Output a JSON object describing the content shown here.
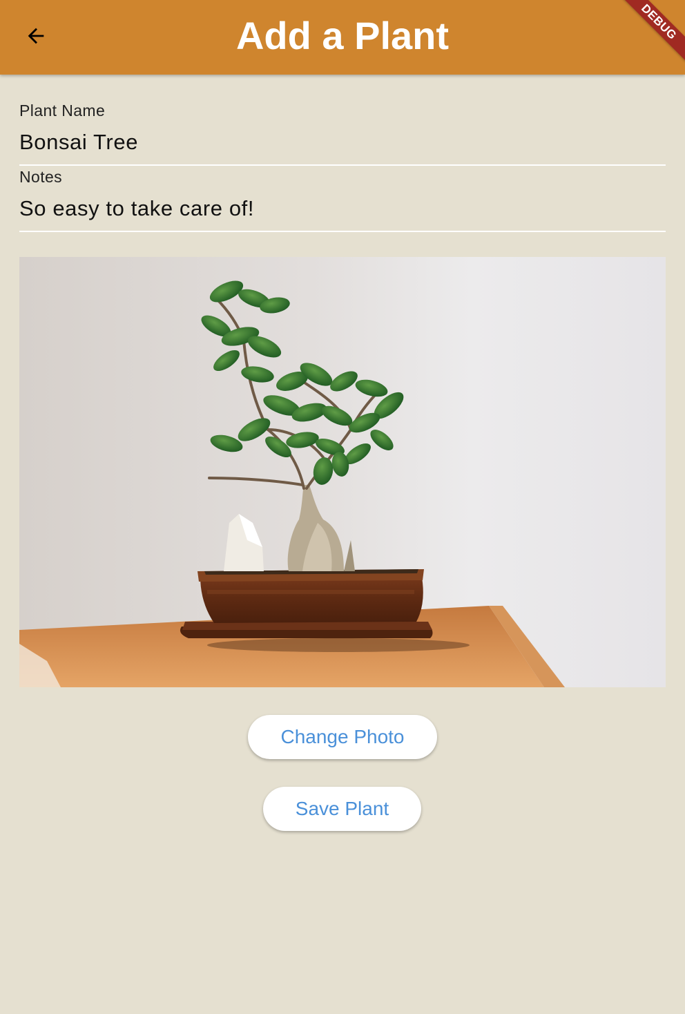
{
  "app_bar": {
    "title": "Add a Plant",
    "back_icon": "arrow-back-icon",
    "debug_banner": "DEBUG"
  },
  "form": {
    "plant_name": {
      "label": "Plant Name",
      "value": "Bonsai Tree"
    },
    "notes": {
      "label": "Notes",
      "value": "So easy to take care of!"
    }
  },
  "photo": {
    "icon": "bonsai-photo"
  },
  "buttons": {
    "change_photo": "Change Photo",
    "save_plant": "Save Plant"
  },
  "colors": {
    "app_bar": "#cf852e",
    "background": "#e5e0d0",
    "button_text": "#4a90d9",
    "debug_banner": "#a02a22"
  }
}
